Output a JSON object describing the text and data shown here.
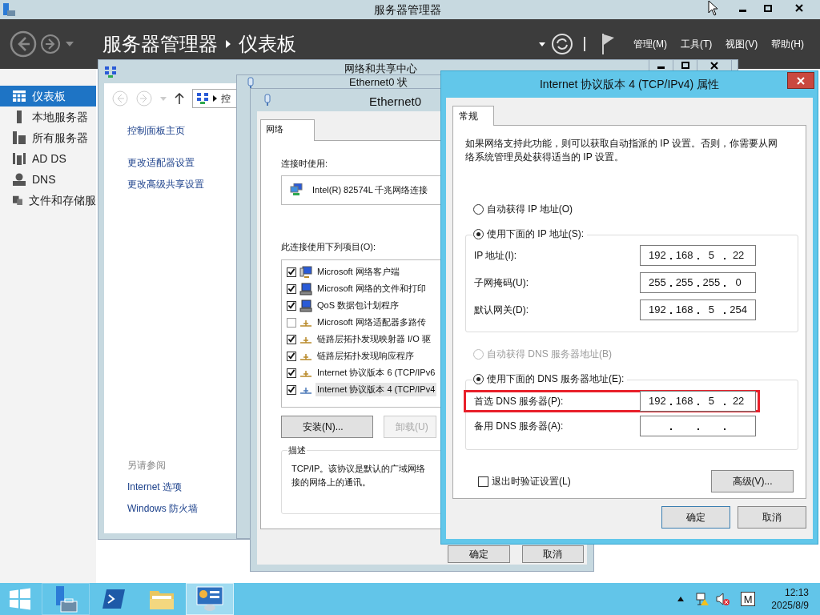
{
  "server_manager": {
    "title": "服务器管理器",
    "breadcrumb": [
      "服务器管理器",
      "仪表板"
    ],
    "menu": [
      "管理(M)",
      "工具(T)",
      "视图(V)",
      "帮助(H)"
    ],
    "sidebar": [
      {
        "label": "仪表板",
        "kind": "dashboard",
        "selected": true
      },
      {
        "label": "本地服务器",
        "kind": "local",
        "selected": false
      },
      {
        "label": "所有服务器",
        "kind": "all",
        "selected": false
      },
      {
        "label": "AD DS",
        "kind": "adds",
        "selected": false
      },
      {
        "label": "DNS",
        "kind": "dns",
        "selected": false
      },
      {
        "label": "文件和存储服",
        "kind": "files",
        "selected": false
      }
    ]
  },
  "network_center": {
    "title": "网络和共享中心",
    "address": "控",
    "links": [
      "控制面板主页",
      "更改适配器设置",
      "更改高级共享设置"
    ],
    "see_also_heading": "另请参阅",
    "see_also": [
      "Internet 选项",
      "Windows 防火墙"
    ]
  },
  "status_window": {
    "title": "Ethernet0 状"
  },
  "properties": {
    "title": "Ethernet0",
    "tab": "网络",
    "connect_label": "连接时使用:",
    "adapter": "Intel(R) 82574L 千兆网络连接",
    "items_label": "此连接使用下列项目(O):",
    "items": [
      {
        "label": "Microsoft 网络客户端",
        "kind": "client",
        "checked": true,
        "selected": false
      },
      {
        "label": "Microsoft 网络的文件和打印",
        "kind": "service",
        "checked": true,
        "selected": false
      },
      {
        "label": "QoS 数据包计划程序",
        "kind": "service",
        "checked": true,
        "selected": false
      },
      {
        "label": "Microsoft 网络适配器多路传",
        "kind": "protocol",
        "checked": false,
        "selected": false
      },
      {
        "label": "链路层拓扑发现映射器 I/O 驱",
        "kind": "protocol",
        "checked": true,
        "selected": false
      },
      {
        "label": "链路层拓扑发现响应程序",
        "kind": "protocol",
        "checked": true,
        "selected": false
      },
      {
        "label": "Internet 协议版本 6 (TCP/IPv6",
        "kind": "protocol",
        "checked": true,
        "selected": false
      },
      {
        "label": "Internet 协议版本 4 (TCP/IPv4",
        "kind": "protocol",
        "checked": true,
        "selected": true
      }
    ],
    "buttons": [
      {
        "label": "安装(N)...",
        "disabled": false
      },
      {
        "label": "卸载(U)",
        "disabled": true
      }
    ],
    "description_heading": "描述",
    "description": [
      "TCP/IP。该协议是默认的广域网络",
      "接的网络上的通讯。"
    ],
    "footer_buttons": [
      "确定",
      "取消"
    ]
  },
  "ipv4": {
    "title": "Internet 协议版本 4 (TCP/IPv4) 属性",
    "tab": "常规",
    "intro": "如果网络支持此功能，则可以获取自动指派的 IP 设置。否则，你需要从网络系统管理员处获得适当的 IP 设置。",
    "ip_options": [
      {
        "label": "自动获得 IP 地址(O)",
        "selected": false,
        "disabled": false
      },
      {
        "label": "使用下面的 IP 地址(S):",
        "selected": true,
        "disabled": false
      }
    ],
    "ip_fields": [
      {
        "label": "IP 地址(I):",
        "octets": [
          "192",
          "168",
          "5",
          "22"
        ],
        "highlighted": false
      },
      {
        "label": "子网掩码(U):",
        "octets": [
          "255",
          "255",
          "255",
          "0"
        ],
        "highlighted": false
      },
      {
        "label": "默认网关(D):",
        "octets": [
          "192",
          "168",
          "5",
          "254"
        ],
        "highlighted": false
      }
    ],
    "dns_options": [
      {
        "label": "自动获得 DNS 服务器地址(B)",
        "selected": false,
        "disabled": true
      },
      {
        "label": "使用下面的 DNS 服务器地址(E):",
        "selected": true,
        "disabled": false
      }
    ],
    "dns_fields": [
      {
        "label": "首选 DNS 服务器(P):",
        "octets": [
          "192",
          "168",
          "5",
          "22"
        ],
        "highlighted": true
      },
      {
        "label": "备用 DNS 服务器(A):",
        "highlighted": false
      }
    ],
    "validate": {
      "label": "退出时验证设置(L)",
      "checked": false
    },
    "advanced": "高级(V)...",
    "buttons": [
      {
        "label": "确定",
        "default": true
      },
      {
        "label": "取消",
        "default": false
      }
    ]
  },
  "taskbar": {
    "apps": [
      {
        "kind": "server-manager",
        "selected": false
      },
      {
        "kind": "powershell",
        "selected": false
      },
      {
        "kind": "explorer",
        "selected": false
      },
      {
        "kind": "control-panel",
        "selected": true
      }
    ],
    "ime": "M",
    "time": "12:13",
    "date": "2025/8/9"
  }
}
